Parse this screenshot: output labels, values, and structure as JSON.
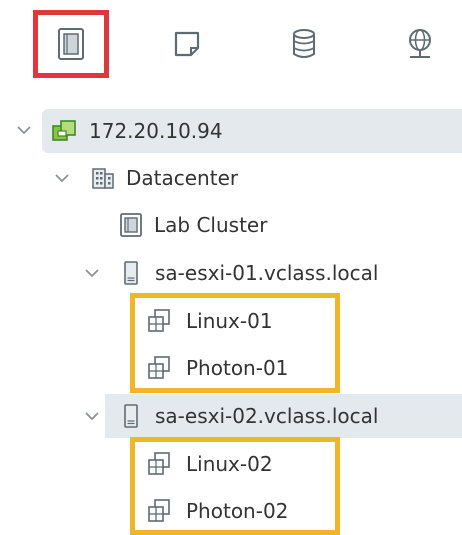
{
  "toolbar": {
    "tabs": [
      {
        "name": "hosts-and-clusters",
        "icon": "hosts-clusters-icon",
        "selected": true
      },
      {
        "name": "vms-and-templates",
        "icon": "vms-templates-icon",
        "selected": false
      },
      {
        "name": "storage",
        "icon": "storage-icon",
        "selected": false
      },
      {
        "name": "networking",
        "icon": "network-icon",
        "selected": false
      }
    ],
    "selected_border_color": "#e0363d"
  },
  "tree": {
    "vcenter": {
      "label": "172.20.10.94",
      "icon": "vcenter-icon"
    },
    "datacenter": {
      "label": "Datacenter",
      "icon": "datacenter-icon"
    },
    "cluster": {
      "label": "Lab Cluster",
      "icon": "cluster-icon"
    },
    "host1": {
      "label": "sa-esxi-01.vclass.local",
      "icon": "host-icon"
    },
    "host1_vms": [
      {
        "label": "Linux-01",
        "icon": "vm-icon"
      },
      {
        "label": "Photon-01",
        "icon": "vm-icon"
      }
    ],
    "host2": {
      "label": "sa-esxi-02.vclass.local",
      "icon": "host-icon"
    },
    "host2_vms": [
      {
        "label": "Linux-02",
        "icon": "vm-icon"
      },
      {
        "label": "Photon-02",
        "icon": "vm-icon"
      }
    ],
    "highlight_color": "#f0b629"
  }
}
